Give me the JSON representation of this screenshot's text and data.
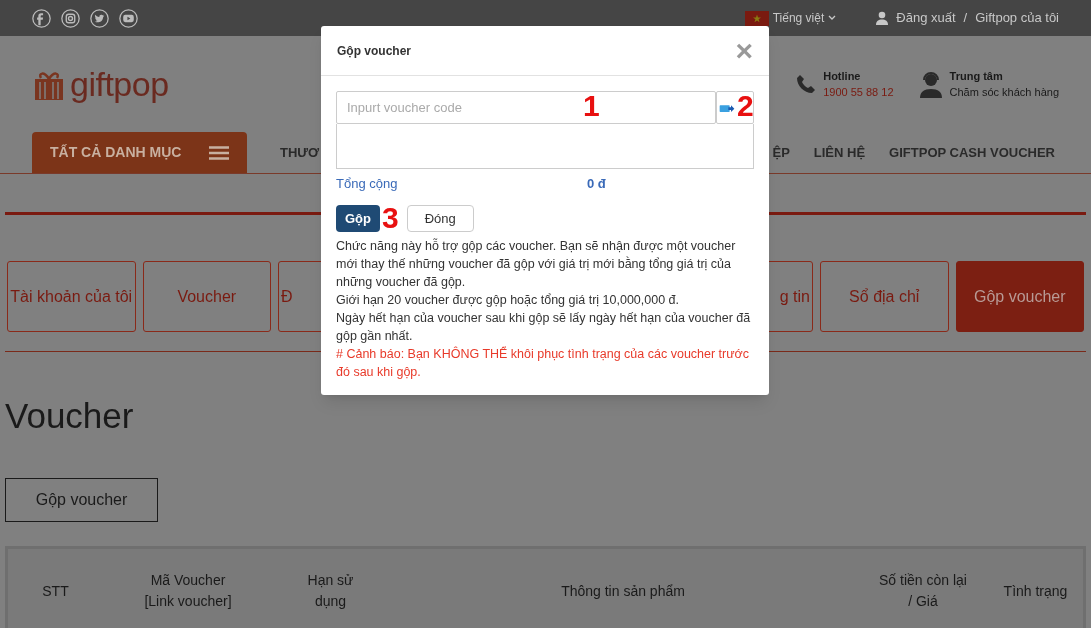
{
  "top_bar": {
    "language": "Tiếng việt",
    "links": [
      "Đăng xuất",
      "Giftpop của tôi"
    ],
    "separator": "/"
  },
  "header": {
    "logo": "giftpop",
    "hotline": {
      "label": "Hotline",
      "number": "1900 55 88 12"
    },
    "support": {
      "label": "Trung tâm",
      "text": "Chăm sóc khách hàng"
    }
  },
  "nav": {
    "category_button": "TẤT CẢ DANH MỤC",
    "items": [
      "THƯƠ",
      "ỆP",
      "LIÊN HỆ",
      "GIFTPOP CASH VOUCHER"
    ]
  },
  "account_tabs": [
    {
      "label": "Tài khoản của tôi",
      "selected": false
    },
    {
      "label": "Voucher",
      "selected": false
    },
    {
      "label": "Đ",
      "selected": false,
      "kind": "clipped_end"
    },
    {
      "label": "g tin",
      "selected": false,
      "kind": "clipped_start"
    },
    {
      "label": "Sổ địa chỉ",
      "selected": false
    },
    {
      "label": "Gộp voucher",
      "selected": true
    }
  ],
  "page_title": "Voucher",
  "merge_button": "Gộp voucher",
  "table": {
    "columns": [
      "STT",
      "Mã Voucher\n[Link voucher]",
      "Hạn sử\ndụng",
      "Thông tin sản phẩm",
      "Số tiền còn lại\n/ Giá",
      "Tình trạng"
    ]
  },
  "dialog": {
    "title": "Gộp voucher",
    "close": "×",
    "input_placeholder": "Inpurt voucher code",
    "total_label": "Tổng cộng",
    "total_value": "0 đ",
    "buttons": [
      {
        "label": "Gộp",
        "kind": "primary"
      },
      {
        "label": "Đóng",
        "kind": "secondary"
      }
    ],
    "info_lines": [
      "Chức năng này hỗ trợ gộp các voucher. Bạn sẽ nhận được một voucher mới thay thế những voucher đã gộp với giá trị mới bằng tổng giá trị của những voucher đã gộp.",
      "Giới hạn 20 voucher được gộp hoặc tổng giá trị 10,000,000 đ.",
      "Ngày hết hạn của voucher sau khi gộp sẽ lấy ngày hết hạn của voucher đã gộp gần nhất."
    ],
    "warning": "# Cảnh báo: Bạn KHÔNG THỂ khôi phục tình trạng của các voucher trước đó sau khi gộp.",
    "annotations": [
      "1",
      "2",
      "3"
    ]
  }
}
